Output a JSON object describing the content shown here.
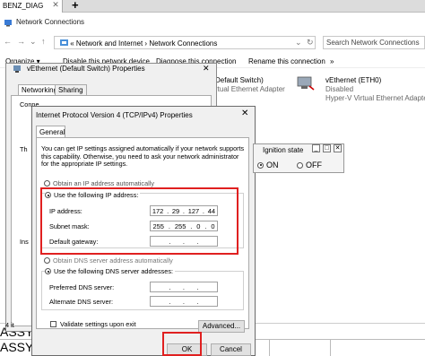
{
  "tab": {
    "title": "BENZ_DIAG",
    "close": "✕",
    "new": "+"
  },
  "window": {
    "title": "Network Connections"
  },
  "address": {
    "sep1": "«",
    "crumb1": "Network and Internet",
    "sep2": "›",
    "crumb2": "Network Connections"
  },
  "search": {
    "placeholder": "Search Network Connections"
  },
  "commands": {
    "organize": "Organize ▾",
    "disable": "Disable this network device",
    "diagnose": "Diagnose this connection",
    "rename": "Rename this connection",
    "more": "»"
  },
  "adapters": [
    {
      "name": "Default Switch)",
      "status": "",
      "device": "rtual Ethernet Adapter"
    },
    {
      "name": "vEthernet (ETH0)",
      "status": "Disabled",
      "device": "Hyper-V Virtual Ethernet Adapter"
    }
  ],
  "props_dialog": {
    "title": "vEthernet (Default Switch) Properties",
    "close": "✕",
    "tabs": [
      "Networking",
      "Sharing"
    ],
    "side_text": [
      "Conne",
      "Th",
      "Ins"
    ],
    "footer_text": "4 it"
  },
  "ipv4": {
    "title": "Internet Protocol Version 4 (TCP/IPv4) Properties",
    "close": "✕",
    "tab": "General",
    "info": "You can get IP settings assigned automatically if your network supports this capability. Otherwise, you need to ask your network administrator for the appropriate IP settings.",
    "auto_ip": "Obtain an IP address automatically",
    "use_ip": "Use the following IP address:",
    "ip_label": "IP address:",
    "ip_value": [
      "172",
      "29",
      "127",
      "44"
    ],
    "mask_label": "Subnet mask:",
    "mask_value": [
      "255",
      "255",
      "0",
      "0"
    ],
    "gateway_label": "Default gateway:",
    "gateway_value": [
      ".",
      ".",
      "."
    ],
    "auto_dns": "Obtain DNS server address automatically",
    "use_dns": "Use the following DNS server addresses:",
    "pref_dns_label": "Preferred DNS server:",
    "alt_dns_label": "Alternate DNS server:",
    "dns_value": [
      ".",
      ".",
      "."
    ],
    "validate": "Validate settings upon exit",
    "advanced": "Advanced...",
    "ok": "OK",
    "cancel": "Cancel"
  },
  "ignition": {
    "title": "Ignition state",
    "on": "ON",
    "off": "OFF",
    "state": "ON"
  },
  "background_text": [
    "ASSY",
    "ASSY"
  ],
  "colors": {
    "highlight": "#e02020",
    "accent": "#0078d7"
  }
}
